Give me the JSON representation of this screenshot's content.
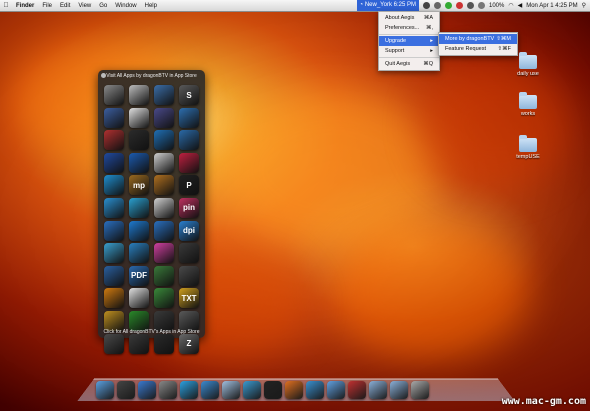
{
  "menubar": {
    "apple_icon": "apple-icon",
    "items": [
      "Finder",
      "File",
      "Edit",
      "View",
      "Go",
      "Window",
      "Help"
    ],
    "status_title": "New_York 6:25 PM",
    "battery": "100%",
    "clock": "Mon Apr 1  4:25 PM"
  },
  "aegis_menu": {
    "items": [
      {
        "label": "About Aegis",
        "shortcut": "⌘A"
      },
      {
        "label": "Preferences...",
        "shortcut": "⌘,"
      },
      {
        "label": "Upgrade",
        "shortcut": "▸"
      },
      {
        "label": "Support",
        "shortcut": "▸"
      },
      {
        "label": "Quit Aegis",
        "shortcut": "⌘Q"
      }
    ]
  },
  "upgrade_submenu": {
    "items": [
      {
        "label": "More by dragonBTV",
        "shortcut": "⇧⌘M"
      },
      {
        "label": "Feature Request",
        "shortcut": "⇧⌘F"
      }
    ]
  },
  "panel": {
    "header": "Visit All Apps by dragonBTV in App Store",
    "footer": "Click for All dragonBTV's Apps in App Store",
    "apps": [
      {
        "text": "",
        "color": "#8a8a8a"
      },
      {
        "text": "",
        "color": "#bdbdbd"
      },
      {
        "text": "",
        "color": "#3b6ea8"
      },
      {
        "text": "S",
        "color": "#5a5a5a"
      },
      {
        "text": "",
        "color": "#3c5fa0"
      },
      {
        "text": "",
        "color": "#e0e0e0"
      },
      {
        "text": "",
        "color": "#4a4a8a"
      },
      {
        "text": "",
        "color": "#2d6fb0"
      },
      {
        "text": "",
        "color": "#b03030"
      },
      {
        "text": "",
        "color": "#2b2b2b"
      },
      {
        "text": "",
        "color": "#1f6fb5"
      },
      {
        "text": "",
        "color": "#2a6aa8"
      },
      {
        "text": "",
        "color": "#204aa0"
      },
      {
        "text": "",
        "color": "#1c5bb0"
      },
      {
        "text": "",
        "color": "#cfcfcf"
      },
      {
        "text": "",
        "color": "#c02040"
      },
      {
        "text": "",
        "color": "#1f8fd0"
      },
      {
        "text": "mp",
        "color": "#9a6a20"
      },
      {
        "text": "",
        "color": "#b07020"
      },
      {
        "text": "P",
        "color": "#202020"
      },
      {
        "text": "",
        "color": "#2a8fd0"
      },
      {
        "text": "",
        "color": "#2aa0d0"
      },
      {
        "text": "",
        "color": "#d0d0d0"
      },
      {
        "text": "pin",
        "color": "#c03060"
      },
      {
        "text": "",
        "color": "#2a6fc0"
      },
      {
        "text": "",
        "color": "#1e7ad0"
      },
      {
        "text": "",
        "color": "#2a70c0"
      },
      {
        "text": "dpi",
        "color": "#2a80d0"
      },
      {
        "text": "",
        "color": "#3aa0d0"
      },
      {
        "text": "",
        "color": "#2a80c0"
      },
      {
        "text": "",
        "color": "#d040a0"
      },
      {
        "text": "",
        "color": "#3a3a3a"
      },
      {
        "text": "",
        "color": "#2a60a0"
      },
      {
        "text": "PDF",
        "color": "#2a6ab0"
      },
      {
        "text": "",
        "color": "#3a7a3a"
      },
      {
        "text": "",
        "color": "#4a4a4a"
      },
      {
        "text": "",
        "color": "#d07a10"
      },
      {
        "text": "",
        "color": "#e0e0e0"
      },
      {
        "text": "",
        "color": "#3a8a3a"
      },
      {
        "text": "TXT",
        "color": "#d0a020"
      },
      {
        "text": "",
        "color": "#c09020"
      },
      {
        "text": "",
        "color": "#2a8a2a"
      },
      {
        "text": "",
        "color": "#3a3a3a"
      },
      {
        "text": "",
        "color": "#5a5a5a"
      },
      {
        "text": "",
        "color": "#4a4a4a"
      },
      {
        "text": "",
        "color": "#3a3a3a"
      },
      {
        "text": "",
        "color": "#2a2a2a"
      },
      {
        "text": "Z",
        "color": "#6a6a6a"
      }
    ]
  },
  "folders": [
    {
      "label": "daily use"
    },
    {
      "label": "works"
    },
    {
      "label": "tempUSE"
    }
  ],
  "dock": {
    "icons": [
      "finder-icon",
      "dashboard-icon",
      "app-store-icon",
      "system-prefs-icon",
      "skype-icon",
      "safari-icon",
      "preview-icon",
      "itunes-icon",
      "dvd-icon",
      "firefox-icon",
      "messages-icon",
      "mail-icon",
      "filezilla-icon",
      "folder-icon",
      "folder-icon",
      "trash-icon"
    ]
  },
  "watermark": "www.mac-gm.com"
}
